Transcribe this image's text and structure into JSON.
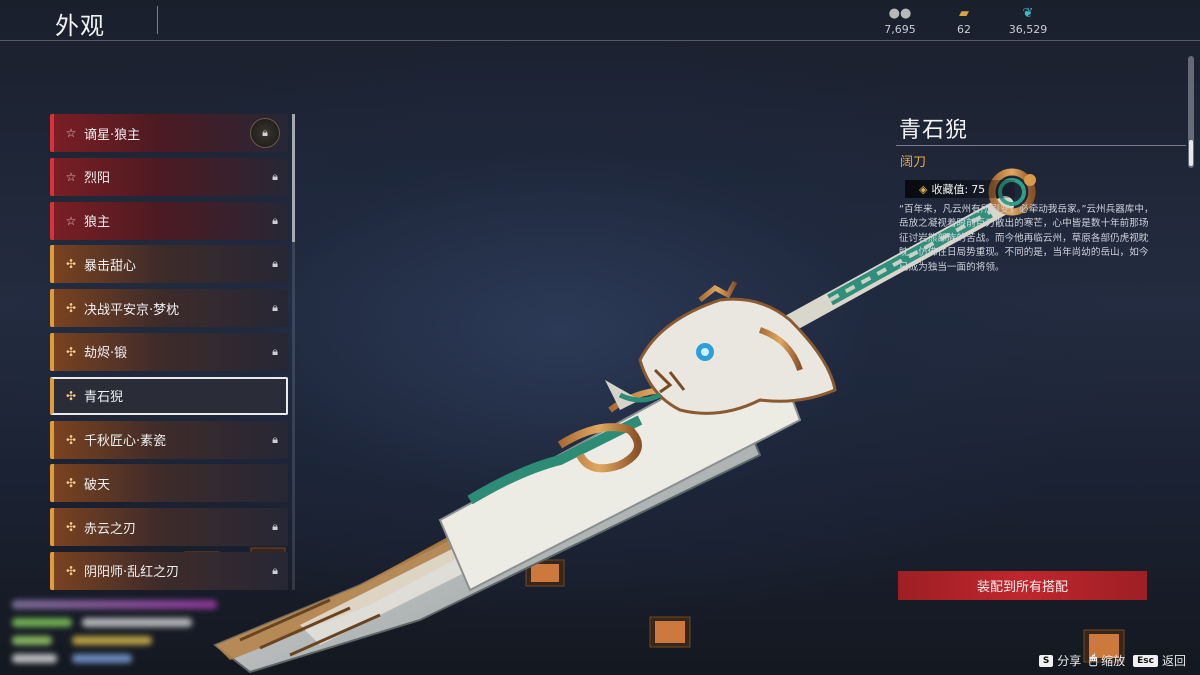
{
  "header": {
    "title": "外观",
    "currencies": [
      {
        "icon": "silver-coin-icon",
        "value": "7,695"
      },
      {
        "icon": "gold-ingot-icon",
        "value": "62"
      },
      {
        "icon": "jade-feather-icon",
        "value": "36,529"
      }
    ]
  },
  "skins": [
    {
      "label": "谪星·狼主",
      "rarity": "red",
      "locked": true
    },
    {
      "label": "烈阳",
      "rarity": "red",
      "locked": true
    },
    {
      "label": "狼主",
      "rarity": "red",
      "locked": true
    },
    {
      "label": "暴击甜心",
      "rarity": "orange",
      "locked": true
    },
    {
      "label": "决战平安京·梦枕",
      "rarity": "orange",
      "locked": true
    },
    {
      "label": "劫烬·锻",
      "rarity": "orange",
      "locked": true
    },
    {
      "label": "青石猊",
      "rarity": "orange",
      "locked": false,
      "selected": true
    },
    {
      "label": "千秋匠心·素瓷",
      "rarity": "orange",
      "locked": true
    },
    {
      "label": "破天",
      "rarity": "orange",
      "locked": false
    },
    {
      "label": "赤云之刃",
      "rarity": "orange",
      "locked": true
    },
    {
      "label": "阴阳师·乱红之刃",
      "rarity": "orange",
      "locked": true
    }
  ],
  "detail": {
    "name": "青石猊",
    "type": "阔刀",
    "collection_label": "收藏值:",
    "collection_value": "75",
    "description": "“百年来，凡云州有所剧变，必牵动我岳家。”云州兵器库中，岳放之凝视着眼前巨刃散出的寒芒，心中皆是数十年前那场征讨岩熊部族的苦战。而今他再临云州，草原各部仍虎视眈眈，仿佛往日局势重现。不同的是，当年尚幼的岳山，如今已成为独当一面的将领。",
    "equip_button": "装配到所有搭配"
  },
  "hints": [
    {
      "key": "S",
      "label": "分享"
    },
    {
      "key": "mouse-icon",
      "label": "缩放"
    },
    {
      "key": "Esc",
      "label": "返回"
    }
  ],
  "colors": {
    "red_accent": "#d8333a",
    "orange_accent": "#e19b3a",
    "equip_button": "#c0262d",
    "type_text": "#e2a94a"
  }
}
